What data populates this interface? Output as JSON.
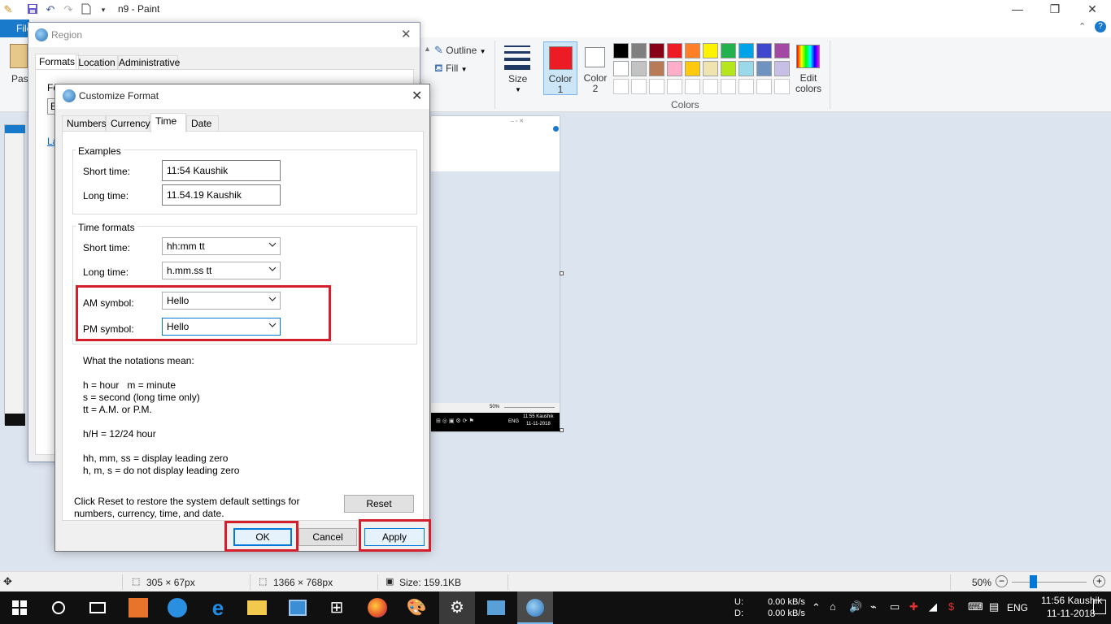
{
  "paint": {
    "title": "n9 - Paint",
    "file_tab": "File",
    "ribbon": {
      "paste_label": "Paste",
      "outline_label": "Outline",
      "fill_label": "Fill",
      "size_label": "Size",
      "color1_label": "Color\n1",
      "color1_line1": "Color",
      "color1_line2": "1",
      "color2_line1": "Color",
      "color2_line2": "2",
      "colors_group_label": "Colors",
      "edit_colors_line1": "Edit",
      "edit_colors_line2": "colors",
      "palette_row1": [
        "#000000",
        "#7f7f7f",
        "#880015",
        "#ed1c24",
        "#ff7f27",
        "#fff200",
        "#22b14c",
        "#00a2e8",
        "#3f48cc",
        "#a349a4"
      ],
      "palette_row2": [
        "#ffffff",
        "#c3c3c3",
        "#b97a57",
        "#ffaec9",
        "#ffc90e",
        "#efe4b0",
        "#b5e61d",
        "#99d9ea",
        "#7092be",
        "#c8bfe7"
      ],
      "color1_value": "#ed1c24",
      "color2_value": "#ffffff"
    },
    "statusbar": {
      "selection_size": "305 × 67px",
      "image_size": "1366 × 768px",
      "file_size": "Size: 159.1KB",
      "zoom": "50%"
    },
    "thumbnail_clock": "11:55 Kaushik",
    "thumbnail_date": "11-11-2018",
    "thumbnail_zoom": "50%",
    "thumbnail_lang": "ENG"
  },
  "region_dialog": {
    "title": "Region",
    "tabs": [
      "Formats",
      "Location",
      "Administrative"
    ],
    "partial_label": "Fo",
    "partial_link": "La",
    "partial_field": "E"
  },
  "customize_format": {
    "title": "Customize Format",
    "tabs": [
      "Numbers",
      "Currency",
      "Time",
      "Date"
    ],
    "active_tab": "Time",
    "examples": {
      "group_title": "Examples",
      "short_time_label": "Short time:",
      "short_time_value": "11:54 Kaushik",
      "long_time_label": "Long time:",
      "long_time_value": "11.54.19 Kaushik"
    },
    "time_formats": {
      "group_title": "Time formats",
      "short_time_label": "Short time:",
      "short_time_value": "hh:mm tt",
      "long_time_label": "Long time:",
      "long_time_value": "h.mm.ss tt",
      "am_label": "AM symbol:",
      "am_value": "Hello",
      "pm_label": "PM symbol:",
      "pm_value": "Hello"
    },
    "notations": {
      "heading": "What the notations mean:",
      "line1": "h = hour   m = minute",
      "line2": "s = second (long time only)",
      "line3": "tt = A.M. or P.M.",
      "line4": "h/H = 12/24 hour",
      "line5": "hh, mm, ss = display leading zero",
      "line6": "h, m, s = do not display leading zero"
    },
    "reset_text_line1": "Click Reset to restore the system default settings for",
    "reset_text_line2": "numbers, currency, time, and date.",
    "reset_button": "Reset",
    "ok_button": "OK",
    "cancel_button": "Cancel",
    "apply_button": "Apply"
  },
  "taskbar": {
    "net_up_label": "U:",
    "net_down_label": "D:",
    "net_up": "0.00 kB/s",
    "net_down": "0.00 kB/s",
    "lang": "ENG",
    "clock_time": "11:56 Kaushik",
    "clock_date": "11-11-2018"
  },
  "colors": {
    "accent": "#0078d7",
    "highlight_red": "#d21f2b",
    "file_tab": "#1979ca"
  }
}
